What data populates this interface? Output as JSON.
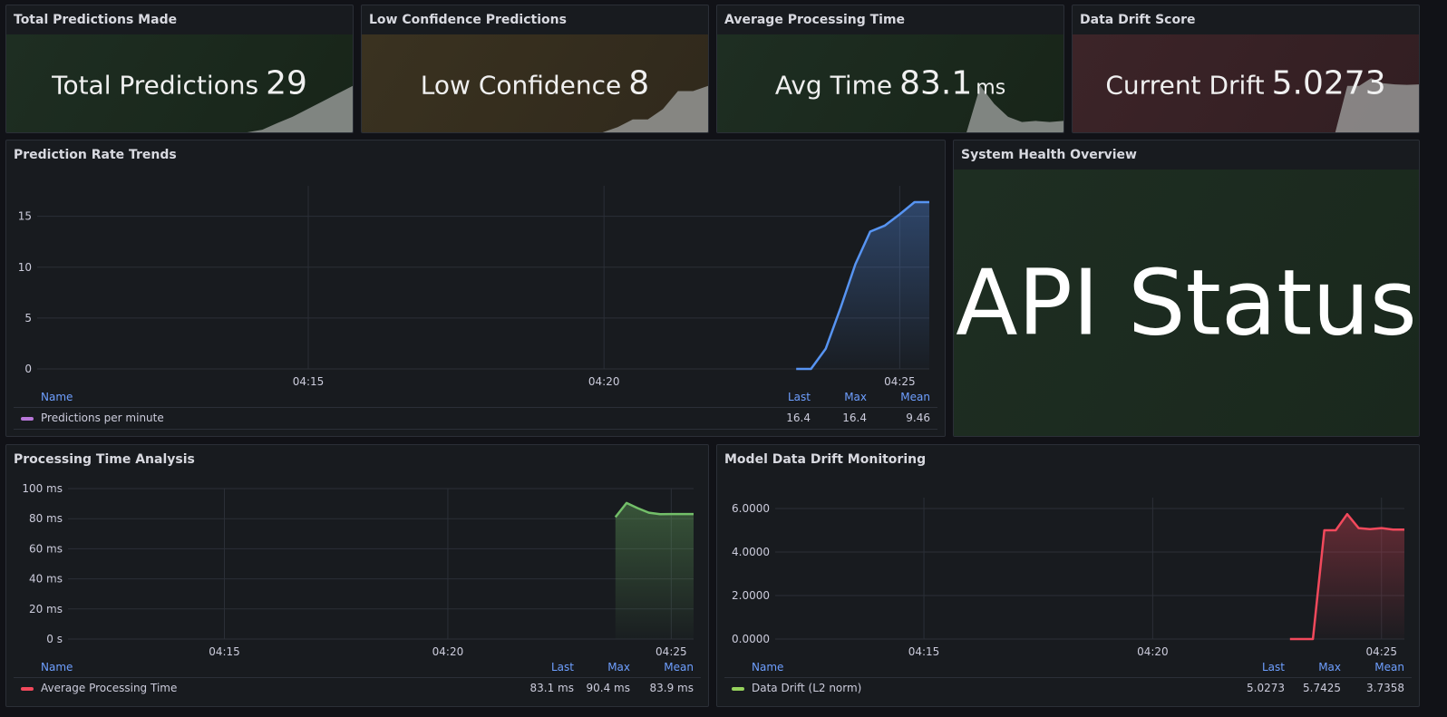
{
  "colors": {
    "green_bg": "#1a2a1f",
    "yellow_bg": "#3a3120",
    "red_bg": "#3a2226",
    "blue": "#5794f2",
    "green": "#73bf69",
    "red": "#f2495c",
    "purple": "#b877d9",
    "lime": "#96d25d",
    "spark": "#a3a6a4"
  },
  "stats": [
    {
      "title": "Total Predictions Made",
      "label": "Total Predictions",
      "value": "29",
      "unit": "",
      "spark": [
        0,
        0,
        0,
        0,
        0,
        0,
        0,
        0,
        0,
        0,
        0,
        0,
        0,
        0,
        0,
        0,
        0,
        0.05,
        0.18,
        0.3,
        0.45,
        0.6,
        0.75,
        0.9
      ]
    },
    {
      "title": "Low Confidence Predictions",
      "label": "Low Confidence",
      "value": "8",
      "unit": "",
      "spark": [
        0,
        0,
        0,
        0,
        0,
        0,
        0,
        0,
        0,
        0,
        0,
        0,
        0,
        0,
        0,
        0,
        0,
        0.1,
        0.25,
        0.25,
        0.45,
        0.8,
        0.8,
        0.9
      ]
    },
    {
      "title": "Average Processing Time",
      "label": "Avg Time",
      "value": "83.1",
      "unit": "ms",
      "spark": [
        0,
        0,
        0,
        0,
        0,
        0,
        0,
        0,
        0,
        0,
        0,
        0,
        0,
        0,
        0,
        0,
        0,
        0,
        0,
        0.9,
        0.55,
        0.3,
        0.2,
        0.22,
        0.2,
        0.22
      ]
    },
    {
      "title": "Data Drift Score",
      "label": "Current Drift",
      "value": "5.0273",
      "unit": "",
      "spark": [
        0,
        0,
        0,
        0,
        0,
        0,
        0,
        0,
        0,
        0,
        0,
        0,
        0,
        0,
        0,
        0,
        0,
        0,
        0,
        0,
        0,
        0,
        0,
        0.9,
        0.9,
        1.05,
        0.95,
        0.93,
        0.92,
        0.93
      ]
    }
  ],
  "prediction_rate": {
    "title": "Prediction Rate Trends",
    "legend": {
      "name_header": "Name",
      "last_header": "Last",
      "max_header": "Max",
      "mean_header": "Mean"
    },
    "series_name": "Predictions per minute",
    "last": "16.4",
    "max": "16.4",
    "mean": "9.46"
  },
  "health": {
    "title": "System Health Overview",
    "text": "API Status"
  },
  "processing_time": {
    "title": "Processing Time Analysis",
    "legend": {
      "name_header": "Name",
      "last_header": "Last",
      "max_header": "Max",
      "mean_header": "Mean"
    },
    "series_name": "Average Processing Time",
    "last": "83.1 ms",
    "max": "90.4 ms",
    "mean": "83.9 ms"
  },
  "drift": {
    "title": "Model Data Drift Monitoring",
    "legend": {
      "name_header": "Name",
      "last_header": "Last",
      "max_header": "Max",
      "mean_header": "Mean"
    },
    "series_name": "Data Drift (L2 norm)",
    "last": "5.0273",
    "max": "5.7425",
    "mean": "3.7358"
  },
  "chart_data": [
    {
      "type": "line",
      "title": "Prediction Rate Trends",
      "x_ticks": [
        "04:15",
        "04:20",
        "04:25"
      ],
      "y_ticks": [
        "0",
        "5",
        "10",
        "15"
      ],
      "ylim": [
        0,
        18
      ],
      "x": [
        "04:23:15",
        "04:23:30",
        "04:23:45",
        "04:24:00",
        "04:24:15",
        "04:24:30",
        "04:24:45",
        "04:25:00",
        "04:25:15",
        "04:25:30"
      ],
      "series": [
        {
          "name": "Predictions per minute",
          "values": [
            0,
            0,
            2,
            6,
            10.3,
            13.5,
            14.1,
            15.2,
            16.4,
            16.4
          ]
        }
      ]
    },
    {
      "type": "line",
      "title": "Processing Time Analysis",
      "x_ticks": [
        "04:15",
        "04:20",
        "04:25"
      ],
      "y_ticks": [
        "0 s",
        "20 ms",
        "40 ms",
        "60 ms",
        "80 ms",
        "100 ms"
      ],
      "ylim": [
        0,
        100
      ],
      "x": [
        "04:23:45",
        "04:24:00",
        "04:24:15",
        "04:24:30",
        "04:24:45",
        "04:25:00",
        "04:25:15",
        "04:25:30"
      ],
      "series": [
        {
          "name": "Average Processing Time",
          "values": [
            81,
            90.4,
            87,
            84,
            83,
            83.1,
            83.1,
            83.1
          ]
        }
      ]
    },
    {
      "type": "line",
      "title": "Model Data Drift Monitoring",
      "x_ticks": [
        "04:15",
        "04:20",
        "04:25"
      ],
      "y_ticks": [
        "0.0000",
        "2.0000",
        "4.0000",
        "6.0000"
      ],
      "ylim": [
        0,
        6.5
      ],
      "x": [
        "04:23:00",
        "04:23:15",
        "04:23:30",
        "04:23:45",
        "04:24:00",
        "04:24:15",
        "04:24:30",
        "04:24:45",
        "04:25:00",
        "04:25:15",
        "04:25:30"
      ],
      "series": [
        {
          "name": "Data Drift (L2 norm)",
          "values": [
            0,
            0,
            0,
            5.0,
            5.0,
            5.7425,
            5.1,
            5.05,
            5.1,
            5.03,
            5.0273
          ]
        }
      ]
    }
  ]
}
